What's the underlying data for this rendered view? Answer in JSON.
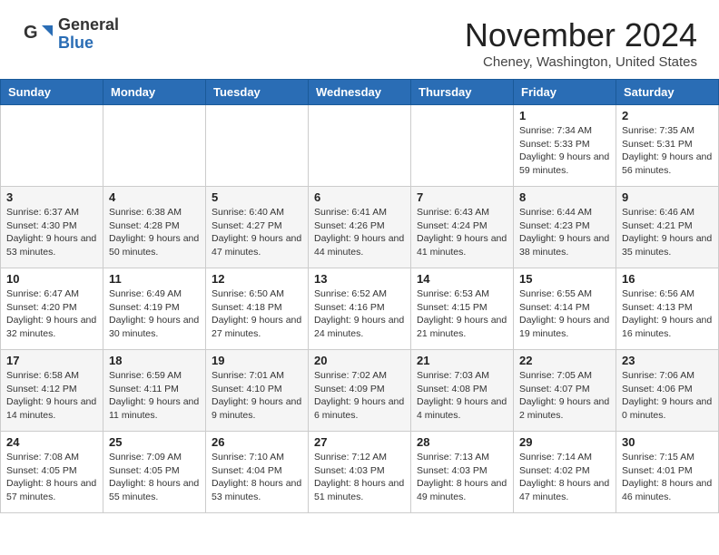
{
  "header": {
    "logo_general": "General",
    "logo_blue": "Blue",
    "month": "November 2024",
    "location": "Cheney, Washington, United States"
  },
  "weekdays": [
    "Sunday",
    "Monday",
    "Tuesday",
    "Wednesday",
    "Thursday",
    "Friday",
    "Saturday"
  ],
  "weeks": [
    [
      {
        "day": "",
        "info": ""
      },
      {
        "day": "",
        "info": ""
      },
      {
        "day": "",
        "info": ""
      },
      {
        "day": "",
        "info": ""
      },
      {
        "day": "",
        "info": ""
      },
      {
        "day": "1",
        "info": "Sunrise: 7:34 AM\nSunset: 5:33 PM\nDaylight: 9 hours and 59 minutes."
      },
      {
        "day": "2",
        "info": "Sunrise: 7:35 AM\nSunset: 5:31 PM\nDaylight: 9 hours and 56 minutes."
      }
    ],
    [
      {
        "day": "3",
        "info": "Sunrise: 6:37 AM\nSunset: 4:30 PM\nDaylight: 9 hours and 53 minutes."
      },
      {
        "day": "4",
        "info": "Sunrise: 6:38 AM\nSunset: 4:28 PM\nDaylight: 9 hours and 50 minutes."
      },
      {
        "day": "5",
        "info": "Sunrise: 6:40 AM\nSunset: 4:27 PM\nDaylight: 9 hours and 47 minutes."
      },
      {
        "day": "6",
        "info": "Sunrise: 6:41 AM\nSunset: 4:26 PM\nDaylight: 9 hours and 44 minutes."
      },
      {
        "day": "7",
        "info": "Sunrise: 6:43 AM\nSunset: 4:24 PM\nDaylight: 9 hours and 41 minutes."
      },
      {
        "day": "8",
        "info": "Sunrise: 6:44 AM\nSunset: 4:23 PM\nDaylight: 9 hours and 38 minutes."
      },
      {
        "day": "9",
        "info": "Sunrise: 6:46 AM\nSunset: 4:21 PM\nDaylight: 9 hours and 35 minutes."
      }
    ],
    [
      {
        "day": "10",
        "info": "Sunrise: 6:47 AM\nSunset: 4:20 PM\nDaylight: 9 hours and 32 minutes."
      },
      {
        "day": "11",
        "info": "Sunrise: 6:49 AM\nSunset: 4:19 PM\nDaylight: 9 hours and 30 minutes."
      },
      {
        "day": "12",
        "info": "Sunrise: 6:50 AM\nSunset: 4:18 PM\nDaylight: 9 hours and 27 minutes."
      },
      {
        "day": "13",
        "info": "Sunrise: 6:52 AM\nSunset: 4:16 PM\nDaylight: 9 hours and 24 minutes."
      },
      {
        "day": "14",
        "info": "Sunrise: 6:53 AM\nSunset: 4:15 PM\nDaylight: 9 hours and 21 minutes."
      },
      {
        "day": "15",
        "info": "Sunrise: 6:55 AM\nSunset: 4:14 PM\nDaylight: 9 hours and 19 minutes."
      },
      {
        "day": "16",
        "info": "Sunrise: 6:56 AM\nSunset: 4:13 PM\nDaylight: 9 hours and 16 minutes."
      }
    ],
    [
      {
        "day": "17",
        "info": "Sunrise: 6:58 AM\nSunset: 4:12 PM\nDaylight: 9 hours and 14 minutes."
      },
      {
        "day": "18",
        "info": "Sunrise: 6:59 AM\nSunset: 4:11 PM\nDaylight: 9 hours and 11 minutes."
      },
      {
        "day": "19",
        "info": "Sunrise: 7:01 AM\nSunset: 4:10 PM\nDaylight: 9 hours and 9 minutes."
      },
      {
        "day": "20",
        "info": "Sunrise: 7:02 AM\nSunset: 4:09 PM\nDaylight: 9 hours and 6 minutes."
      },
      {
        "day": "21",
        "info": "Sunrise: 7:03 AM\nSunset: 4:08 PM\nDaylight: 9 hours and 4 minutes."
      },
      {
        "day": "22",
        "info": "Sunrise: 7:05 AM\nSunset: 4:07 PM\nDaylight: 9 hours and 2 minutes."
      },
      {
        "day": "23",
        "info": "Sunrise: 7:06 AM\nSunset: 4:06 PM\nDaylight: 9 hours and 0 minutes."
      }
    ],
    [
      {
        "day": "24",
        "info": "Sunrise: 7:08 AM\nSunset: 4:05 PM\nDaylight: 8 hours and 57 minutes."
      },
      {
        "day": "25",
        "info": "Sunrise: 7:09 AM\nSunset: 4:05 PM\nDaylight: 8 hours and 55 minutes."
      },
      {
        "day": "26",
        "info": "Sunrise: 7:10 AM\nSunset: 4:04 PM\nDaylight: 8 hours and 53 minutes."
      },
      {
        "day": "27",
        "info": "Sunrise: 7:12 AM\nSunset: 4:03 PM\nDaylight: 8 hours and 51 minutes."
      },
      {
        "day": "28",
        "info": "Sunrise: 7:13 AM\nSunset: 4:03 PM\nDaylight: 8 hours and 49 minutes."
      },
      {
        "day": "29",
        "info": "Sunrise: 7:14 AM\nSunset: 4:02 PM\nDaylight: 8 hours and 47 minutes."
      },
      {
        "day": "30",
        "info": "Sunrise: 7:15 AM\nSunset: 4:01 PM\nDaylight: 8 hours and 46 minutes."
      }
    ]
  ]
}
